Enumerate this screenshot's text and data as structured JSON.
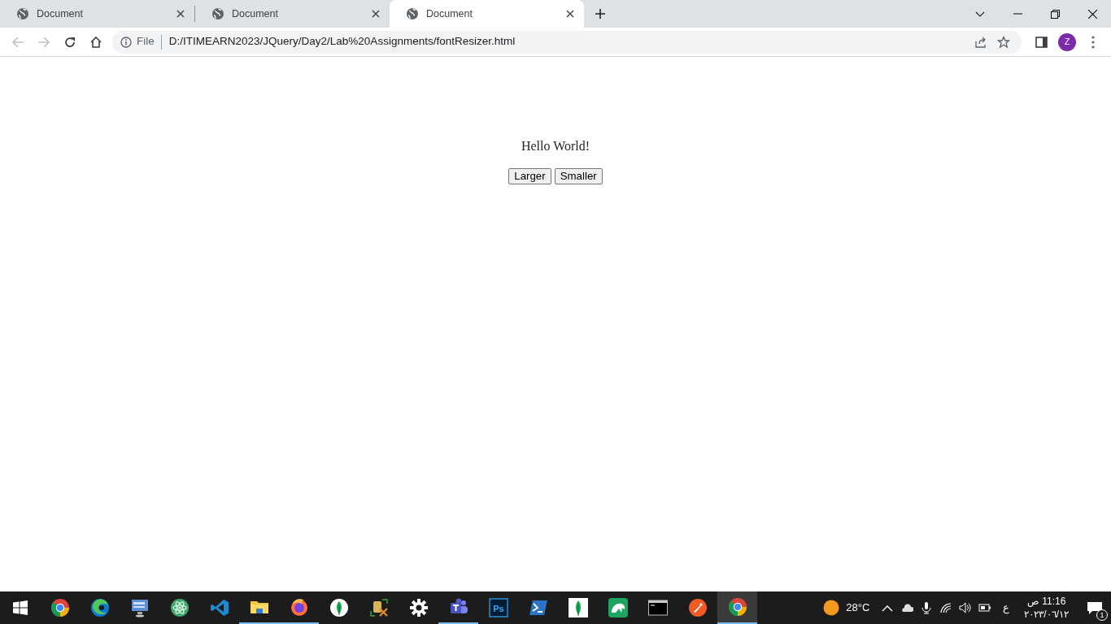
{
  "tabs": [
    {
      "title": "Document",
      "selected": false
    },
    {
      "title": "Document",
      "selected": false
    },
    {
      "title": "Document",
      "selected": true
    }
  ],
  "address_bar": {
    "scheme": "File",
    "url": "D:/ITIMEARN2023/JQuery/Day2/Lab%20Assignments/fontResizer.html"
  },
  "profile": {
    "initial": "Z"
  },
  "page": {
    "text": "Hello World!",
    "buttons": [
      "Larger",
      "Smaller"
    ]
  },
  "taskbar": {
    "apps": [
      {
        "kind": "chrome",
        "running": false,
        "selected": false
      },
      {
        "kind": "edge",
        "running": false,
        "selected": false
      },
      {
        "kind": "monitor",
        "running": false,
        "selected": false
      },
      {
        "kind": "atom",
        "running": false,
        "selected": false
      },
      {
        "kind": "vscode",
        "running": false,
        "selected": false
      },
      {
        "kind": "folder",
        "running": true,
        "selected": false
      },
      {
        "kind": "firefox",
        "running": true,
        "selected": false
      },
      {
        "kind": "leaf",
        "running": false,
        "selected": false
      },
      {
        "kind": "tools",
        "running": false,
        "selected": false
      },
      {
        "kind": "gear",
        "running": false,
        "selected": false
      },
      {
        "kind": "teams",
        "running": true,
        "selected": false
      },
      {
        "kind": "photoshop",
        "label": "Ps",
        "running": false,
        "selected": false
      },
      {
        "kind": "powershell",
        "running": false,
        "selected": false
      },
      {
        "kind": "leafsquare",
        "running": false,
        "selected": false
      },
      {
        "kind": "dolphin",
        "running": false,
        "selected": false
      },
      {
        "kind": "console",
        "running": false,
        "selected": false
      },
      {
        "kind": "postman",
        "running": false,
        "selected": false
      },
      {
        "kind": "chrome",
        "running": true,
        "selected": true
      }
    ],
    "weather": "28°C",
    "language": "ع",
    "time": "11:16 ص",
    "date": "٢٠٢٣/٠٦/١٢",
    "notifications": "1"
  }
}
